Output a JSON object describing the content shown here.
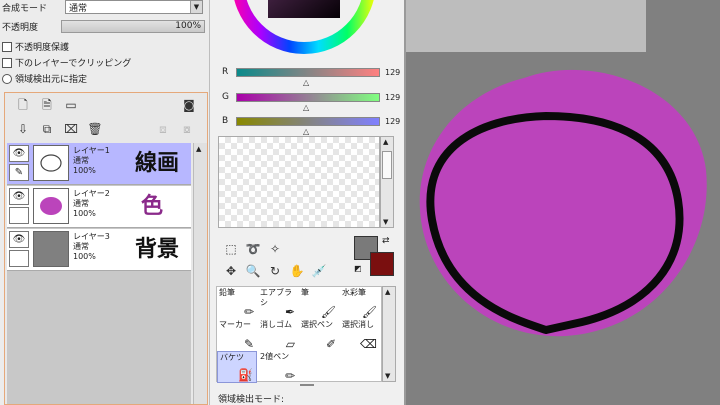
{
  "layer_props": {
    "blend_mode_label": "合成モード",
    "blend_mode_value": "通常",
    "opacity_label": "不透明度",
    "opacity_value": "100%",
    "protect_opacity_label": "不透明度保護",
    "clip_lower_label": "下のレイヤーでクリッピング",
    "selection_source_label": "領域検出元に指定"
  },
  "layers": [
    {
      "name": "レイヤー1",
      "mode": "通常",
      "opacity": "100%",
      "caption": "線画",
      "selected": true
    },
    {
      "name": "レイヤー2",
      "mode": "通常",
      "opacity": "100%",
      "caption": "色",
      "selected": false
    },
    {
      "name": "レイヤー3",
      "mode": "通常",
      "opacity": "100%",
      "caption": "背景",
      "selected": false
    }
  ],
  "rgb": {
    "r_label": "R",
    "r_value": "129",
    "g_label": "G",
    "g_value": "129",
    "b_label": "B",
    "b_value": "129"
  },
  "tools": [
    {
      "label": "鉛筆",
      "icon": "pencil-icon"
    },
    {
      "label": "エアブラシ",
      "icon": "airbrush-icon"
    },
    {
      "label": "筆",
      "icon": "brush-icon"
    },
    {
      "label": "水彩筆",
      "icon": "watercolor-icon"
    },
    {
      "label": "マーカー",
      "icon": "marker-icon"
    },
    {
      "label": "消しゴム",
      "icon": "eraser-icon"
    },
    {
      "label": "選択ペン",
      "icon": "select-pen-icon"
    },
    {
      "label": "選択消し",
      "icon": "select-erase-icon"
    },
    {
      "label": "バケツ",
      "icon": "bucket-icon"
    },
    {
      "label": "2値ペン",
      "icon": "binary-pen-icon"
    }
  ],
  "tool_options": {
    "detection_mode_label": "領域検出モード:"
  },
  "colors": {
    "primary": "#7a7a7a",
    "secondary": "#7a0f0f",
    "layer_selected": "#b7b7ff",
    "fill": "#bb44bb",
    "caption_color": "#8a2a8a"
  }
}
